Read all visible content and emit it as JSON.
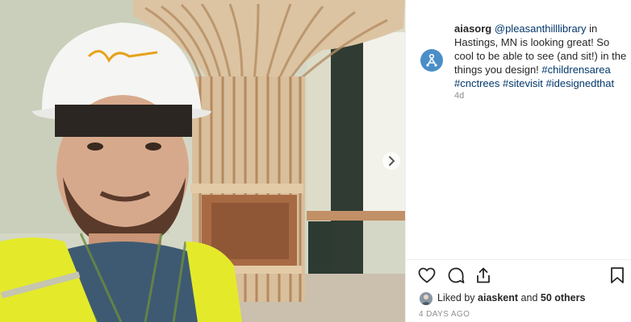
{
  "post": {
    "username": "aiasorg",
    "caption_parts": [
      {
        "type": "mention",
        "text": "@pleasanthilllibrary"
      },
      {
        "type": "text",
        "text": " in Hastings, MN is looking great! So cool to be able to see (and sit!) in the things you design! "
      },
      {
        "type": "hashtag",
        "text": "#childrensarea"
      },
      {
        "type": "text",
        "text": " "
      },
      {
        "type": "hashtag",
        "text": "#cnctrees"
      },
      {
        "type": "text",
        "text": " "
      },
      {
        "type": "hashtag",
        "text": "#sitevisit"
      },
      {
        "type": "text",
        "text": " "
      },
      {
        "type": "hashtag",
        "text": "#idesignedthat"
      }
    ],
    "time_ago": "4d",
    "likes_prefix": "Liked by ",
    "liked_by_user": "aiaskent",
    "likes_and": " and ",
    "likes_others": "50 others",
    "date_label": "4 DAYS AGO"
  },
  "icons": {
    "avatar": "aias-logo-icon",
    "like": "heart-icon",
    "comment": "comment-icon",
    "share": "share-icon",
    "save": "bookmark-icon",
    "next": "chevron-right-icon"
  },
  "colors": {
    "link": "#00376b",
    "muted": "#8e8e8e",
    "avatar_bg": "#4a8ec8"
  }
}
